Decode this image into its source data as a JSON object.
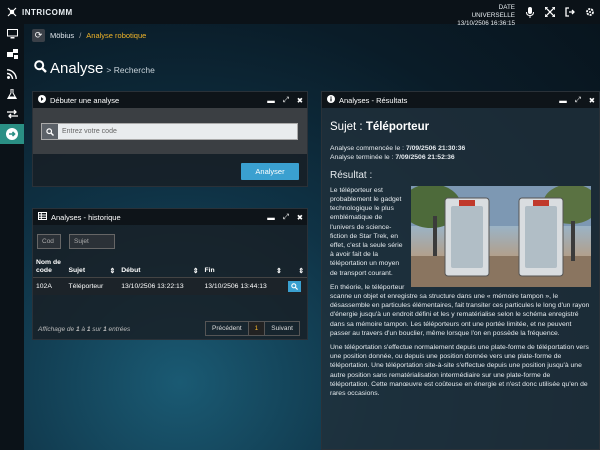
{
  "topbar": {
    "logo_text": "INTRICOMM",
    "date_label": "DATE UNIVERSELLE",
    "date_value": "13/10/2506 16:36:15",
    "icons": [
      "microphone-icon",
      "expand-icon",
      "logout-icon",
      "settings-icon"
    ]
  },
  "sidebar": {
    "items": [
      {
        "name": "monitor",
        "icon": "monitor-icon"
      },
      {
        "name": "network",
        "icon": "network-icon"
      },
      {
        "name": "rss",
        "icon": "rss-icon"
      },
      {
        "name": "lab",
        "icon": "flask-icon"
      },
      {
        "name": "transfer",
        "icon": "transfer-icon"
      },
      {
        "name": "go",
        "icon": "arrow-right-circle-icon"
      }
    ]
  },
  "breadcrumb": {
    "root": "Möbius",
    "sep": "/",
    "current": "Analyse robotique"
  },
  "page": {
    "title": "Analyse",
    "subtitle": "> Recherche"
  },
  "start_panel": {
    "title": "Débuter une analyse",
    "placeholder": "Entrez votre code",
    "button": "Analyser"
  },
  "history_panel": {
    "title": "Analyses - historique",
    "filters": {
      "code": "Cod",
      "subject": "Sujet"
    },
    "columns": [
      "Nom de code",
      "Sujet",
      "Début",
      "Fin"
    ],
    "rows": [
      {
        "code": "102A",
        "subject": "Téléporteur",
        "start": "13/10/2506 13:22:13",
        "end": "13/10/2506 13:44:13"
      }
    ],
    "info_prefix": "Affichage de",
    "info_from": "1",
    "info_mid1": "à",
    "info_to": "1",
    "info_mid2": "sur",
    "info_total": "1",
    "info_suffix": "entrées",
    "pager": {
      "prev": "Précédent",
      "page": "1",
      "next": "Suivant"
    }
  },
  "results_panel": {
    "title": "Analyses - Résultats",
    "subject_label": "Sujet :",
    "subject_value": "Téléporteur",
    "started_label": "Analyse commencée le :",
    "started_value": "7/09/2506 21:30:36",
    "ended_label": "Analyse terminée le :",
    "ended_value": "7/09/2506 21:52:36",
    "result_heading": "Résultat :",
    "p1": "Le téléporteur est probablement le gadget technologique le plus emblématique de l'univers de science-fiction de Star Trek, en effet, c'est la seule série à avoir fait de la téléportation un moyen de transport courant.",
    "p2": "En théorie, le téléporteur scanne un objet et enregistre sa structure dans une « mémoire tampon », le désassemble en particules élémentaires, fait transiter ces particules le long d'un rayon d'énergie jusqu'à un endroit défini et les y rematérialise selon le schéma enregistré dans sa mémoire tampon. Les téléporteurs ont une portée limitée, et ne peuvent passer au travers d'un bouclier, même lorsque l'on en possède la fréquence.",
    "p3": "Une téléportation s'effectue normalement depuis une plate-forme de téléportation vers une position donnée, ou depuis une position donnée vers une plate-forme de téléportation. Une téléportation site-à-site s'effectue depuis une position jusqu'à une autre position sans rematérialisation intermédiaire sur une plate-forme de téléportation. Cette manœuvre est coûteuse en énergie et n'est donc utilisée qu'en de rares occasions."
  },
  "colors": {
    "accent": "#3aa0d0",
    "breadcrumb": "#f0b429",
    "sidebar_active": "#2a8f84"
  }
}
